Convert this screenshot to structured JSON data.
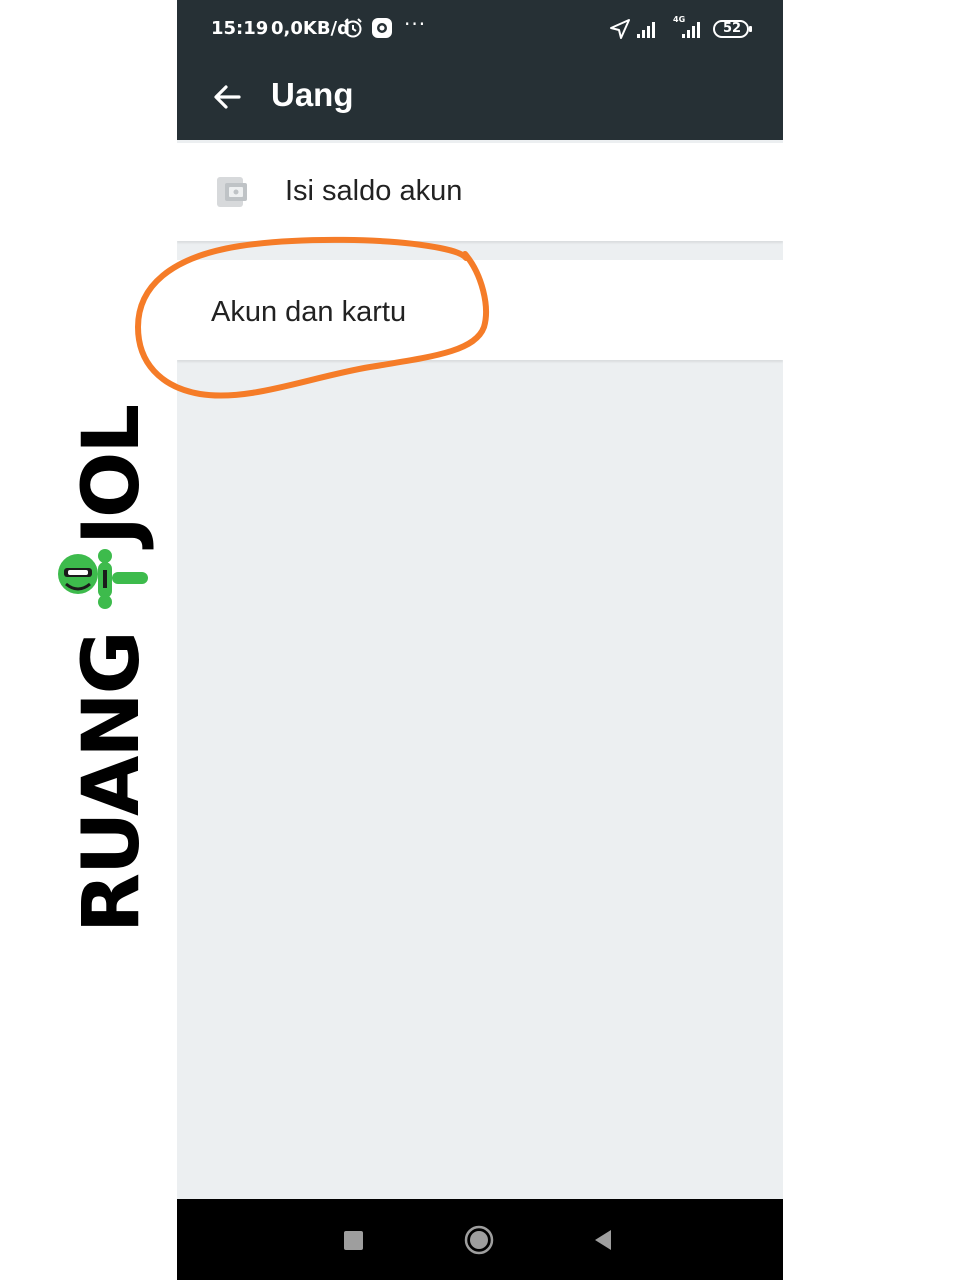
{
  "status_bar": {
    "time": "15:19",
    "network_speed": "0,0KB/d",
    "more": "···",
    "network_type": "4G",
    "battery": "52",
    "icons": [
      "alarm-icon",
      "app-notification-icon",
      "location-arrow-icon",
      "signal-icon",
      "signal-4g-icon",
      "battery-icon"
    ]
  },
  "app_bar": {
    "title": "Uang",
    "back_icon": "arrow-left-icon"
  },
  "menu": {
    "items": [
      {
        "label": "Isi saldo akun",
        "icon": "wallet-icon"
      },
      {
        "label": "Akun dan kartu",
        "highlighted": true
      }
    ]
  },
  "annotation": {
    "highlight_color": "#f57c28"
  },
  "watermark": {
    "text_part1": "RUANG",
    "text_part2": "JOL",
    "logo_color": "#3dbb4c"
  },
  "nav_bar": {
    "buttons": [
      "recent-apps",
      "home",
      "back"
    ]
  },
  "colors": {
    "toolbar": "#263035",
    "content_bg": "#eceff1",
    "text": "#222222"
  }
}
